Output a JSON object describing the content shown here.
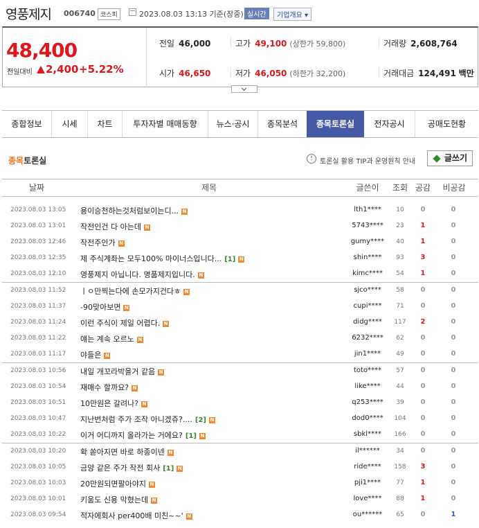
{
  "header": {
    "name": "영풍제지",
    "code": "006740",
    "market": "코스피",
    "datetime": "2023.08.03 13:13 기준(장중)",
    "realtime": "실시간",
    "company_info": "기업개요"
  },
  "price": {
    "current": "48,400",
    "change_label": "전일대비",
    "change": "2,400",
    "change_pct": "+5.22%"
  },
  "stats": {
    "prev_label": "전일",
    "prev": "46,000",
    "high_label": "고가",
    "high": "49,100",
    "upper_limit": "(상한가 59,800)",
    "volume_label": "거래량",
    "volume": "2,608,764",
    "open_label": "시가",
    "open": "46,650",
    "low_label": "저가",
    "low": "46,050",
    "lower_limit": "(하한가 32,200)",
    "amount_label": "거래대금",
    "amount": "124,491",
    "amount_unit": "백만"
  },
  "tabs": [
    "종합정보",
    "시세",
    "차트",
    "투자자별 매매동향",
    "뉴스·공시",
    "종목분석",
    "종목토론실",
    "전자공시",
    "공매도현황"
  ],
  "board": {
    "title_highlight": "종목",
    "title_rest": "토론실",
    "tip": "토론실 활용 TIP과 운영원칙 안내",
    "write": "글쓰기",
    "columns": [
      "날짜",
      "제목",
      "글쓴이",
      "조회",
      "공감",
      "비공감"
    ],
    "new_badge": "N",
    "rows": [
      {
        "date": "2023.08.03 13:05",
        "title": "용이승천하는것처럼보이는디...",
        "comments": "",
        "writer": "lth1****",
        "views": "10",
        "like": "0",
        "dislike": "0"
      },
      {
        "date": "2023.08.03 13:01",
        "title": "작전인건 다 아는데",
        "comments": "",
        "writer": "5743****",
        "views": "23",
        "like": "1",
        "dislike": "0"
      },
      {
        "date": "2023.08.03 12:46",
        "title": "작전주인가",
        "comments": "",
        "writer": "gumy****",
        "views": "40",
        "like": "1",
        "dislike": "0"
      },
      {
        "date": "2023.08.03 12:35",
        "title": "제 주식계좌는 모두100% 마이너스입니다...",
        "comments": "[1]",
        "writer": "shin****",
        "views": "93",
        "like": "3",
        "dislike": "0"
      },
      {
        "date": "2023.08.03 12:10",
        "title": "영풍제지 아닙니다. 명품제지입니다.",
        "comments": "",
        "writer": "kimc****",
        "views": "54",
        "like": "1",
        "dislike": "0"
      },
      {
        "date": "2023.08.03 11:52",
        "title": "ㅣㅇ만찍는다에 손모가지건다ㅎ",
        "comments": "",
        "writer": "sjco****",
        "views": "58",
        "like": "0",
        "dislike": "0"
      },
      {
        "date": "2023.08.03 11:37",
        "title": "-90맞아보면",
        "comments": "",
        "writer": "cupi****",
        "views": "71",
        "like": "0",
        "dislike": "0"
      },
      {
        "date": "2023.08.03 11:24",
        "title": "이런 주식이 제일 어렵다.",
        "comments": "",
        "writer": "didg****",
        "views": "117",
        "like": "2",
        "dislike": "0"
      },
      {
        "date": "2023.08.03 11:22",
        "title": "얘는 계속 오르노",
        "comments": "",
        "writer": "6232****",
        "views": "62",
        "like": "0",
        "dislike": "0"
      },
      {
        "date": "2023.08.03 11:17",
        "title": "야들은",
        "comments": "",
        "writer": "jin1****",
        "views": "49",
        "like": "0",
        "dislike": "0"
      },
      {
        "date": "2023.08.03 10:56",
        "title": "내일 개꼬라박을거 같음",
        "comments": "",
        "writer": "toto****",
        "views": "57",
        "like": "0",
        "dislike": "0"
      },
      {
        "date": "2023.08.03 10:54",
        "title": "재매수 할까요?",
        "comments": "",
        "writer": "like****",
        "views": "44",
        "like": "0",
        "dislike": "0"
      },
      {
        "date": "2023.08.03 10:51",
        "title": "10만원은 갈려나?",
        "comments": "",
        "writer": "q253****",
        "views": "39",
        "like": "0",
        "dislike": "0"
      },
      {
        "date": "2023.08.03 10:47",
        "title": "지난번처럼 주가 조작 아니겠쥬?....",
        "comments": "[2]",
        "writer": "dod0****",
        "views": "104",
        "like": "0",
        "dislike": "0"
      },
      {
        "date": "2023.08.03 10:22",
        "title": "이거 어디까지 올라가는 거에요?",
        "comments": "[1]",
        "writer": "sbkl****",
        "views": "166",
        "like": "0",
        "dislike": "0"
      },
      {
        "date": "2023.08.03 10:20",
        "title": "확 쏟아지면 바로 하종이넨",
        "comments": "",
        "writer": "il******",
        "views": "34",
        "like": "0",
        "dislike": "0"
      },
      {
        "date": "2023.08.03 10:05",
        "title": "금양 같은 주가 작전 회사",
        "comments": "[1]",
        "writer": "ride****",
        "views": "158",
        "like": "3",
        "dislike": "0"
      },
      {
        "date": "2023.08.03 10:03",
        "title": "20만원되면팔아야지",
        "comments": "",
        "writer": "pji1****",
        "views": "77",
        "like": "1",
        "dislike": "0"
      },
      {
        "date": "2023.08.03 10:01",
        "title": "키움도 신용 막혔는데",
        "comments": "",
        "writer": "love****",
        "views": "88",
        "like": "1",
        "dislike": "0"
      },
      {
        "date": "2023.08.03 09:54",
        "title": "적자에회사 per400배 미친~~'",
        "comments": "",
        "writer": "ou******",
        "views": "65",
        "like": "0",
        "dislike": "1"
      }
    ]
  }
}
